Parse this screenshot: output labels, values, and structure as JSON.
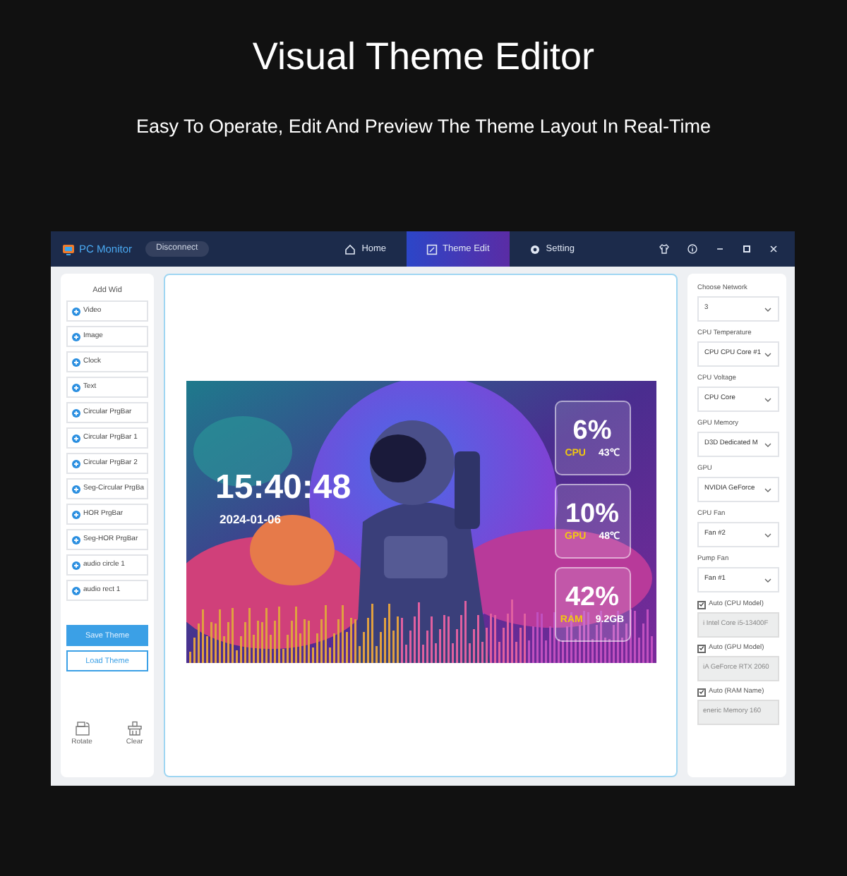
{
  "page": {
    "title": "Visual Theme Editor",
    "subtitle": "Easy To Operate, Edit And Preview The Theme Layout In Real-Time"
  },
  "app": {
    "name": "PC Monitor",
    "connection_button": "Disconnect"
  },
  "nav_tabs": [
    {
      "label": "Home",
      "kind": "home",
      "selected": false
    },
    {
      "label": "Theme Edit",
      "kind": "edit",
      "selected": true
    },
    {
      "label": "Setting",
      "kind": "gear",
      "selected": false
    }
  ],
  "widgets": {
    "title": "Add Wid",
    "items": [
      "Video",
      "Image",
      "Clock",
      "Text",
      "Circular PrgBar",
      "Circular PrgBar 1",
      "Circular PrgBar 2",
      "Seg-Circular PrgBa",
      "HOR PrgBar",
      "Seg-HOR PrgBar",
      "audio circle 1",
      "audio rect 1"
    ]
  },
  "theme_buttons": [
    {
      "label": "Save Theme",
      "kind": "primary"
    },
    {
      "label": "Load Theme",
      "kind": "outline"
    }
  ],
  "tools": [
    {
      "label": "Rotate",
      "kind": "rotate"
    },
    {
      "label": "Clear",
      "kind": "clear"
    }
  ],
  "preview": {
    "time": "15:40:48",
    "date": "2024-01-06",
    "stats": [
      {
        "value": "6%",
        "label": "CPU",
        "detail": "43℃"
      },
      {
        "value": "10%",
        "label": "GPU",
        "detail": "48℃"
      },
      {
        "value": "42%",
        "label": "RAM",
        "detail": "9.2GB"
      }
    ]
  },
  "settings": [
    {
      "kind": "select",
      "label": "Choose Network",
      "value": "3"
    },
    {
      "kind": "select",
      "label": "CPU Temperature",
      "value": "CPU CPU Core #1"
    },
    {
      "kind": "select",
      "label": "CPU Voltage",
      "value": "CPU Core"
    },
    {
      "kind": "select",
      "label": "GPU Memory",
      "value": "D3D Dedicated M"
    },
    {
      "kind": "select",
      "label": "GPU",
      "value": "NVIDIA GeForce"
    },
    {
      "kind": "select",
      "label": "CPU Fan",
      "value": "Fan #2"
    },
    {
      "kind": "select",
      "label": "Pump Fan",
      "value": "Fan #1"
    },
    {
      "kind": "auto",
      "label": "Auto (CPU Model)",
      "checked": true,
      "value": "i Intel Core i5-13400F"
    },
    {
      "kind": "auto",
      "label": "Auto (GPU Model)",
      "checked": true,
      "value": "iA GeForce RTX 2060"
    },
    {
      "kind": "auto",
      "label": "Auto (RAM Name)",
      "checked": true,
      "value": "eneric Memory 160"
    }
  ]
}
